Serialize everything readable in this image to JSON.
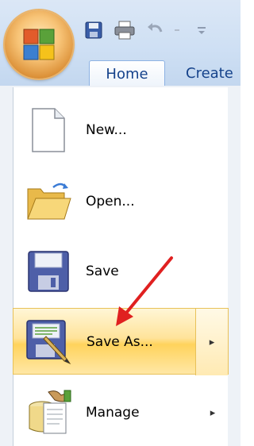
{
  "ribbon": {
    "office_button_icon": "office-logo-icon",
    "quick_access": [
      {
        "name": "save-icon"
      },
      {
        "name": "print-icon"
      },
      {
        "name": "undo-icon"
      },
      {
        "name": "redo-icon"
      },
      {
        "name": "customize-dropdown-icon"
      }
    ],
    "tabs": [
      {
        "label": "Home"
      },
      {
        "label": "Create"
      }
    ]
  },
  "menu": {
    "items": [
      {
        "label": "New...",
        "icon": "new-document-icon",
        "has_submenu": false
      },
      {
        "label": "Open...",
        "icon": "open-folder-icon",
        "has_submenu": false
      },
      {
        "label": "Save",
        "icon": "save-disk-icon",
        "has_submenu": false
      },
      {
        "label": "Save As...",
        "icon": "save-as-icon",
        "has_submenu": true,
        "highlighted": true
      },
      {
        "label": "Manage",
        "icon": "manage-database-icon",
        "has_submenu": true
      }
    ],
    "submenu_arrow": "▸"
  },
  "annotation": {
    "color": "#e02020",
    "target": "Save As..."
  },
  "colors": {
    "highlight": "#ffd35c",
    "ribbon": "#cfe0f4",
    "tab_text": "#15428b"
  }
}
